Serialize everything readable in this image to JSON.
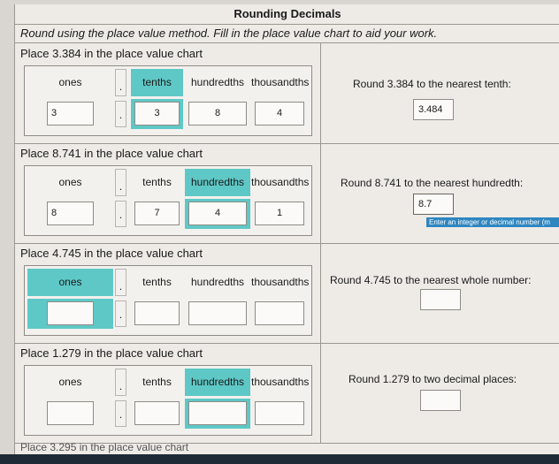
{
  "title": "Rounding Decimals",
  "instructions": "Round using the place value method. Fill in the place value chart to aid your work.",
  "headers": [
    "ones",
    "tenths",
    "hundredths",
    "thousandths"
  ],
  "dot": ".",
  "problems": [
    {
      "prompt": "Place 3.384 in the place value chart",
      "highlight": "tenths",
      "digits": [
        "3",
        "3",
        "8",
        "4"
      ],
      "answer_prompt": "Round 3.384 to the nearest tenth:",
      "answer_value": "3.484",
      "hint": ""
    },
    {
      "prompt": "Place 8.741 in the place value chart",
      "highlight": "hundredths",
      "digits": [
        "8",
        "7",
        "4",
        "1"
      ],
      "answer_prompt": "Round 8.741 to the nearest hundredth:",
      "answer_value": "8.7",
      "hint": "Enter an integer or decimal number (m"
    },
    {
      "prompt": "Place 4.745 in the place value chart",
      "highlight": "ones",
      "digits": [
        "",
        "",
        "",
        ""
      ],
      "answer_prompt": "Round 4.745 to the nearest whole number:",
      "answer_value": "",
      "hint": ""
    },
    {
      "prompt": "Place 1.279 in the place value chart",
      "highlight": "hundredths",
      "digits": [
        "",
        "",
        "",
        ""
      ],
      "answer_prompt": "Round 1.279 to two decimal places:",
      "answer_value": "",
      "hint": ""
    }
  ],
  "footer_partial": "Place 3.295 in the place value chart",
  "colors": {
    "highlight": "#5ec8c6",
    "hint_bg": "#2e86c1"
  }
}
